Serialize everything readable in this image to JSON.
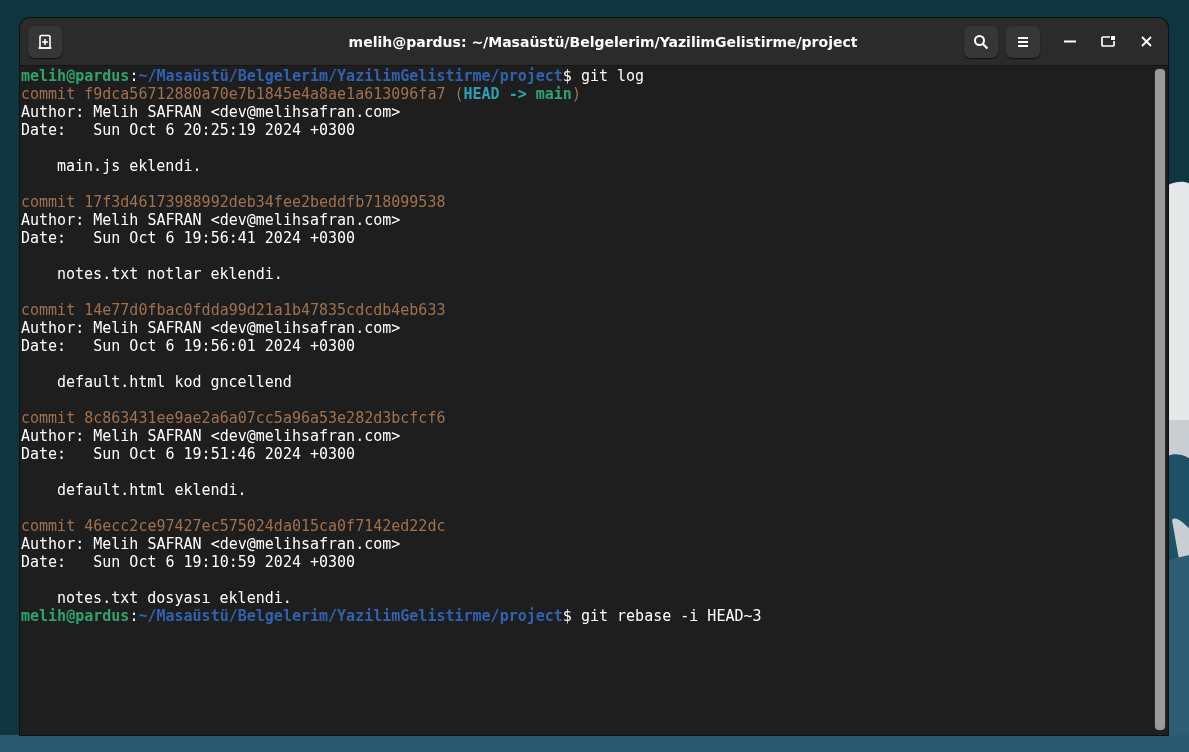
{
  "window": {
    "title": "melih@pardus: ~/Masaüstü/Belgelerim/YazilimGelistirme/project"
  },
  "terminal": {
    "lines": [
      {
        "kind": "prompt",
        "user": "melih@pardus",
        "separator": ":",
        "path": "~/Masaüstü/Belgelerim/YazilimGelistirme/project",
        "command": "$ git log"
      },
      {
        "kind": "commit",
        "label": "commit",
        "hash": "f9dca56712880a70e7b1845e4a8ae1a613096fa7",
        "refs": {
          "open": "(",
          "head": "HEAD ->",
          "branch": "main",
          "close": ")"
        }
      },
      {
        "kind": "text",
        "text": "Author: Melih SAFRAN <dev@melihsafran.com>"
      },
      {
        "kind": "text",
        "text": "Date:   Sun Oct 6 20:25:19 2024 +0300"
      },
      {
        "kind": "blank"
      },
      {
        "kind": "message",
        "text": "main.js eklendi."
      },
      {
        "kind": "blank"
      },
      {
        "kind": "commit",
        "label": "commit",
        "hash": "17f3d46173988992deb34fee2beddfb718099538"
      },
      {
        "kind": "text",
        "text": "Author: Melih SAFRAN <dev@melihsafran.com>"
      },
      {
        "kind": "text",
        "text": "Date:   Sun Oct 6 19:56:41 2024 +0300"
      },
      {
        "kind": "blank"
      },
      {
        "kind": "message",
        "text": "notes.txt notlar eklendi."
      },
      {
        "kind": "blank"
      },
      {
        "kind": "commit",
        "label": "commit",
        "hash": "14e77d0fbac0fdda99d21a1b47835cdcdb4eb633"
      },
      {
        "kind": "text",
        "text": "Author: Melih SAFRAN <dev@melihsafran.com>"
      },
      {
        "kind": "text",
        "text": "Date:   Sun Oct 6 19:56:01 2024 +0300"
      },
      {
        "kind": "blank"
      },
      {
        "kind": "message",
        "text": "default.html kod gncellend"
      },
      {
        "kind": "blank"
      },
      {
        "kind": "commit",
        "label": "commit",
        "hash": "8c863431ee9ae2a6a07cc5a96a53e282d3bcfcf6"
      },
      {
        "kind": "text",
        "text": "Author: Melih SAFRAN <dev@melihsafran.com>"
      },
      {
        "kind": "text",
        "text": "Date:   Sun Oct 6 19:51:46 2024 +0300"
      },
      {
        "kind": "blank"
      },
      {
        "kind": "message",
        "text": "default.html eklendi."
      },
      {
        "kind": "blank"
      },
      {
        "kind": "commit",
        "label": "commit",
        "hash": "46ecc2ce97427ec575024da015ca0f7142ed22dc"
      },
      {
        "kind": "text",
        "text": "Author: Melih SAFRAN <dev@melihsafran.com>"
      },
      {
        "kind": "text",
        "text": "Date:   Sun Oct 6 19:10:59 2024 +0300"
      },
      {
        "kind": "blank"
      },
      {
        "kind": "message",
        "text": "notes.txt dosyası eklendi."
      },
      {
        "kind": "prompt",
        "user": "melih@pardus",
        "separator": ":",
        "path": "~/Masaüstü/Belgelerim/YazilimGelistirme/project",
        "command": "$ git rebase -i HEAD~3"
      }
    ]
  }
}
